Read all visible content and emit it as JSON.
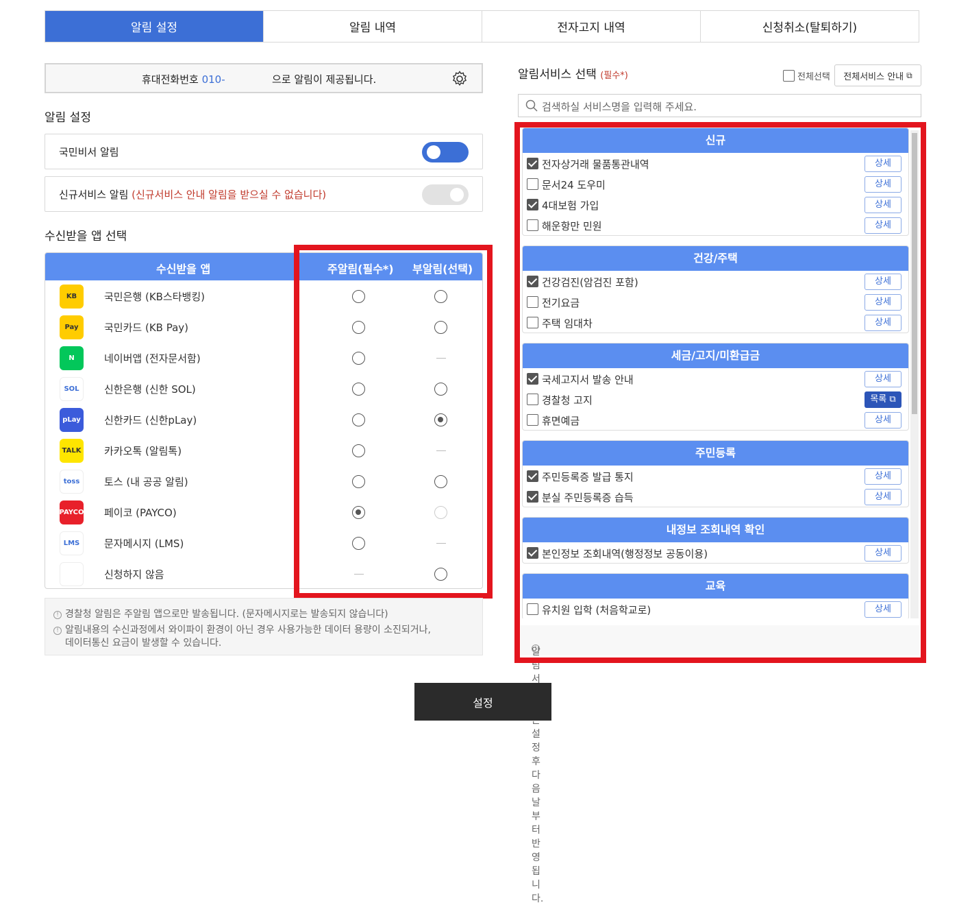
{
  "tabs": [
    "알림 설정",
    "알림 내역",
    "전자고지 내역",
    "신청취소(탈퇴하기)"
  ],
  "phone": {
    "prefix": "휴대전화번호",
    "number": "010-",
    "suffix": "으로 알림이 제공됩니다."
  },
  "alarm_settings": {
    "title": "알림 설정",
    "national_secretary": "국민비서 알림",
    "new_service": "신규서비스 알림",
    "new_service_warning": "(신규서비스 안내 알림을 받으실 수 없습니다)"
  },
  "app_select": {
    "title": "수신받을 앱 선택",
    "headers": {
      "app": "수신받을 앱",
      "main": "주알림(필수*)",
      "sub": "부알림(선택)"
    },
    "apps": [
      {
        "name": "국민은행 (KB스타뱅킹)",
        "logo": "KB",
        "color": "#ffcc00",
        "main": "off",
        "sub": "off"
      },
      {
        "name": "국민카드 (KB Pay)",
        "logo": "Pay",
        "color": "#ffcc00",
        "main": "off",
        "sub": "off"
      },
      {
        "name": "네이버앱 (전자문서함)",
        "logo": "N",
        "color": "#03c75a",
        "main": "off",
        "sub": "none"
      },
      {
        "name": "신한은행 (신한 SOL)",
        "logo": "SOL",
        "color": "#ffffff",
        "main": "off",
        "sub": "off"
      },
      {
        "name": "신한카드 (신한pLay)",
        "logo": "pLay",
        "color": "#3b5bdb",
        "main": "off",
        "sub": "on"
      },
      {
        "name": "카카오톡 (알림톡)",
        "logo": "TALK",
        "color": "#fee500",
        "main": "off",
        "sub": "none"
      },
      {
        "name": "토스 (내 공공 알림)",
        "logo": "toss",
        "color": "#ffffff",
        "main": "off",
        "sub": "off"
      },
      {
        "name": "페이코 (PAYCO)",
        "logo": "PAYCO",
        "color": "#e8202a",
        "main": "on",
        "sub": "disabled"
      },
      {
        "name": "문자메시지 (LMS)",
        "logo": "LMS",
        "color": "#ffffff",
        "main": "off",
        "sub": "none"
      },
      {
        "name": "신청하지 않음",
        "logo": "",
        "color": "#ffffff",
        "main": "none",
        "sub": "off"
      }
    ]
  },
  "notes": [
    "경찰청 알림은 주알림 앱으로만 발송됩니다. (문자메시지로는 발송되지 않습니다)",
    "알림내용의 수신과정에서 와이파이 환경이 아닌 경우 사용가능한 데이터 용량이 소진되거나,",
    "데이터통신 요금이 발생할 수 있습니다."
  ],
  "service": {
    "title": "알림서비스 선택",
    "required": "(필수*)",
    "select_all": "전체선택",
    "all_guide": "전체서비스 안내",
    "search_placeholder": "검색하실 서비스명을 입력해 주세요.",
    "detail_label": "상세",
    "list_label": "목록",
    "groups": [
      {
        "name": "신규",
        "items": [
          {
            "name": "전자상거래 물품통관내역",
            "checked": true,
            "btn": "상세"
          },
          {
            "name": "문서24 도우미",
            "checked": false,
            "btn": "상세"
          },
          {
            "name": "4대보험 가입",
            "checked": true,
            "btn": "상세"
          },
          {
            "name": "해운항만 민원",
            "checked": false,
            "btn": "상세"
          }
        ]
      },
      {
        "name": "건강/주택",
        "items": [
          {
            "name": "건강검진(암검진 포함)",
            "checked": true,
            "btn": "상세"
          },
          {
            "name": "전기요금",
            "checked": false,
            "btn": "상세"
          },
          {
            "name": "주택 임대차",
            "checked": false,
            "btn": "상세"
          }
        ]
      },
      {
        "name": "세금/고지/미환급금",
        "items": [
          {
            "name": "국세고지서 발송 안내",
            "checked": true,
            "btn": "상세"
          },
          {
            "name": "경찰청 고지",
            "checked": false,
            "btn": "목록"
          },
          {
            "name": "휴면예금",
            "checked": false,
            "btn": "상세"
          }
        ]
      },
      {
        "name": "주민등록",
        "items": [
          {
            "name": "주민등록증 발급 통지",
            "checked": true,
            "btn": "상세"
          },
          {
            "name": "분실 주민등록증 습득",
            "checked": true,
            "btn": "상세"
          }
        ]
      },
      {
        "name": "내정보 조회내역 확인",
        "items": [
          {
            "name": "본인정보 조회내역(행정정보 공동이용)",
            "checked": true,
            "btn": "상세"
          }
        ]
      },
      {
        "name": "교육",
        "items": [
          {
            "name": "유치원 입학 (처음학교로)",
            "checked": false,
            "btn": "상세"
          }
        ]
      }
    ],
    "footer_note": "알림서비스는 설정 후 다음날부터 반영됩니다."
  },
  "submit_label": "설정",
  "colors": {
    "accent": "#3c6fd6",
    "header_blue": "#5b8ef0",
    "highlight_red": "#e3151e",
    "warn_red": "#c0392b"
  }
}
